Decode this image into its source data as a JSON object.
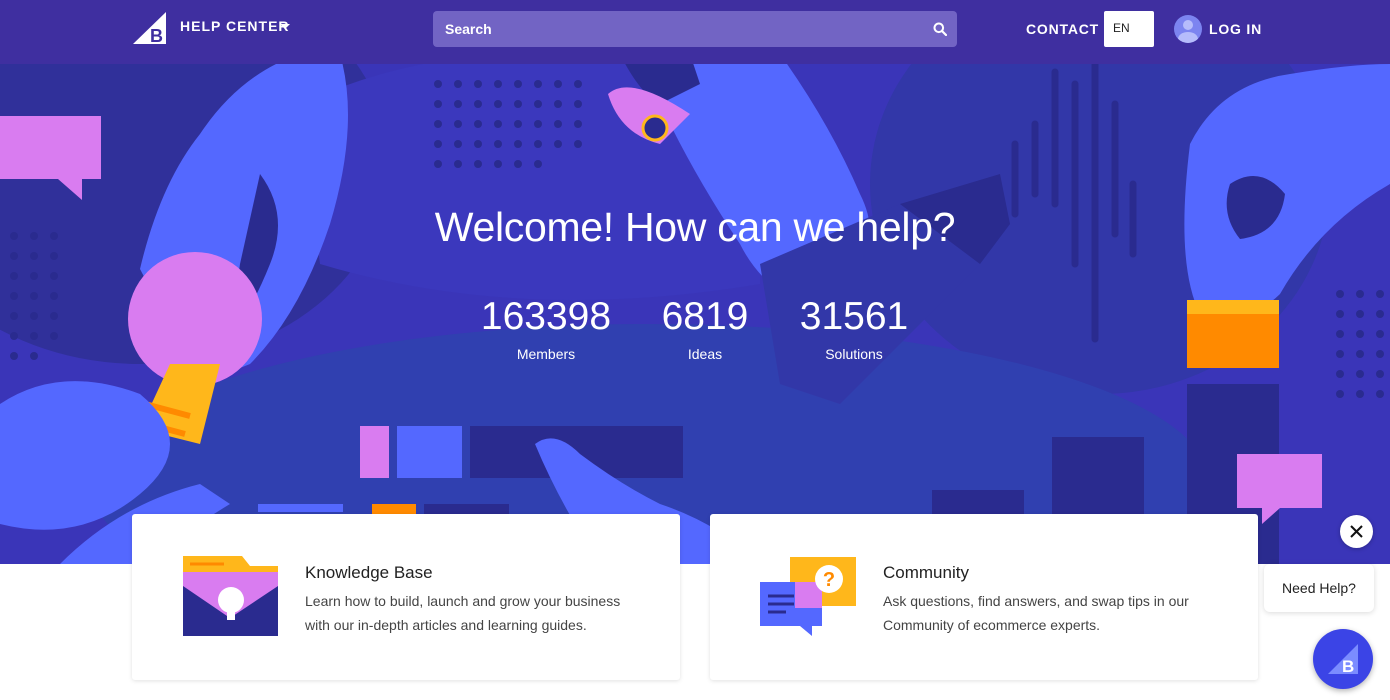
{
  "header": {
    "brand_label": "HELP CENTER",
    "search_placeholder": "Search",
    "contact_label": "CONTACT",
    "language": "EN",
    "login_label": "LOG IN"
  },
  "hero": {
    "title": "Welcome! How can we help?",
    "stats": [
      {
        "value": "163398",
        "label": "Members"
      },
      {
        "value": "6819",
        "label": "Ideas"
      },
      {
        "value": "31561",
        "label": "Solutions"
      }
    ]
  },
  "cards": [
    {
      "title": "Knowledge Base",
      "description": "Learn how to build, launch and grow your business with our in-depth articles and learning guides.",
      "icon": "folder-lightbulb-icon"
    },
    {
      "title": "Community",
      "description": "Ask questions, find answers, and swap tips in our Community of ecommerce experts.",
      "icon": "chat-question-icon"
    }
  ],
  "help_widget": {
    "need_help_label": "Need Help?",
    "close_icon": "close-icon",
    "chat_icon": "chat-logo-icon"
  },
  "colors": {
    "header_bg": "#3f2fa0",
    "hero_bg": "#3a35b8",
    "accent_pink": "#d97cf0",
    "accent_orange": "#ff8a00",
    "accent_blue": "#5468ff"
  }
}
